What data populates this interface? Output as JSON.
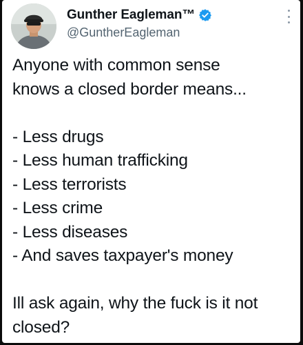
{
  "tweet": {
    "author": {
      "display_name": "Gunther Eagleman™",
      "handle": "@GuntherEagleman",
      "verified": true,
      "verified_color": "#1d9bf0"
    },
    "menu_icon": "more-vertical-icon",
    "body_lines": [
      "Anyone with common sense",
      "knows a closed border means...",
      "",
      "- Less drugs",
      "- Less human trafficking",
      "- Less terrorists",
      "- Less crime",
      "- Less diseases",
      "- And saves taxpayer's money",
      "",
      "Ill ask again,  why the fuck is it not",
      "closed?"
    ]
  },
  "colors": {
    "background": "#0b0b0b",
    "card": "#ffffff",
    "text": "#0f1419",
    "secondary_text": "#536471"
  }
}
